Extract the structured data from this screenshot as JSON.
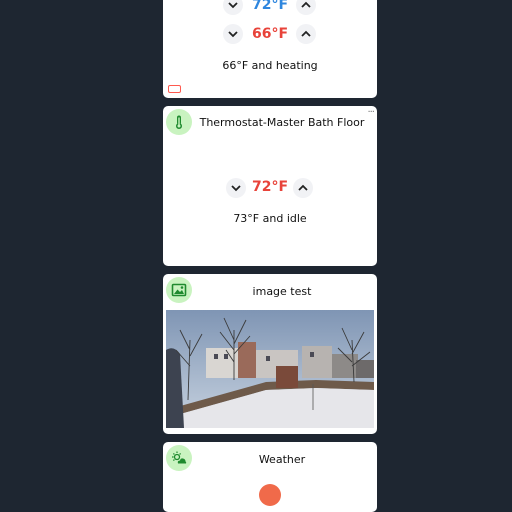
{
  "colors": {
    "background": "#1e2631",
    "cool": "#2e86de",
    "heat": "#e8433a",
    "icon_bg": "#c9f3c0",
    "icon_fg": "#1f8a2e",
    "badge": "#ff5a4f"
  },
  "card1": {
    "cool_setpoint": "72°F",
    "heat_setpoint": "66°F",
    "status": "66°F and heating"
  },
  "card2": {
    "icon": "thermometer-icon",
    "title": "Thermostat-Master Bath Floor",
    "more": "···",
    "setpoint": "72°F",
    "status": "73°F and idle"
  },
  "card3": {
    "icon": "image-icon",
    "title": "image test"
  },
  "card4": {
    "icon": "weather-icon",
    "title": "Weather"
  }
}
